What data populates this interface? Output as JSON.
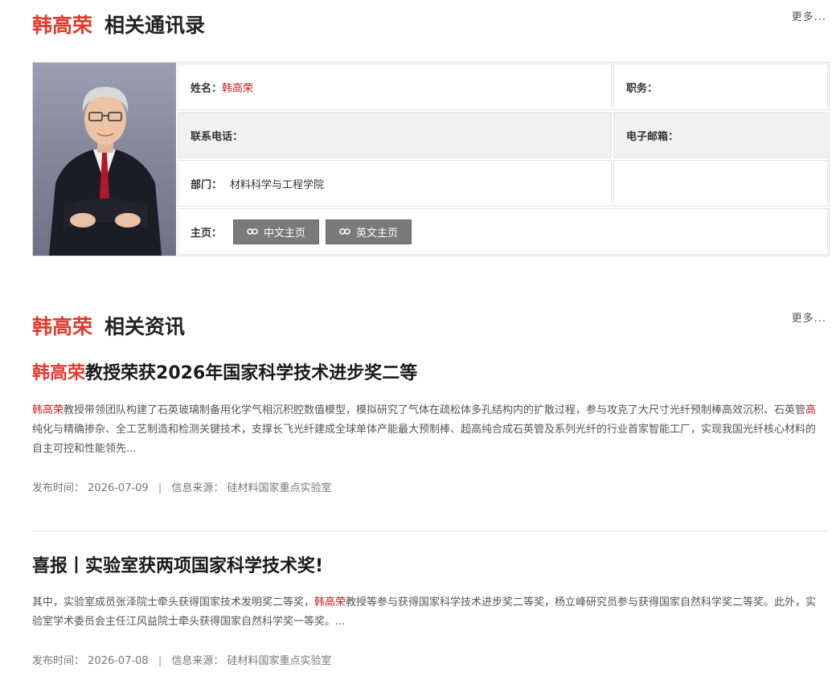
{
  "person_name": "韩高荣",
  "contacts_section": {
    "title": "相关通讯录",
    "more": "更多..."
  },
  "contact": {
    "name_label": "姓名：",
    "name_value": "韩高荣",
    "position_label": "职务：",
    "phone_label": "联系电话：",
    "email_label": "电子邮箱：",
    "dept_label": "部门：",
    "dept_value": "材料科学与工程学院",
    "homepage_label": "主页：",
    "btn_cn": "中文主页",
    "btn_en": "英文主页"
  },
  "news_section": {
    "title": "相关资讯",
    "more": "更多..."
  },
  "news": [
    {
      "title_highlight": "韩高荣",
      "title_rest": "教授荣获2026年国家科学技术进步奖二等",
      "body_pre": "",
      "body_highlight": "韩高荣",
      "body_post_a": "教授带领团队构建了石英玻璃制备用化学气相沉积腔数值模型，模拟研究了气体在疏松体多孔结构内的扩散过程，参与攻克了大尺寸光纤预制棒高效沉积、石英管",
      "body_highlight2": "高",
      "body_post_b": "纯化与精确掺杂、全工艺制造和检测关键技术，支撑长飞光纤建成全球单体产能最大预制棒、超高纯合成石英管及系列光纤的行业首家智能工厂，实现我国光纤核心材料的自主可控和性能领先...",
      "date_label": "发布时间：",
      "date": "2026-07-09",
      "source_label": "信息来源：",
      "source": "硅材料国家重点实验室"
    },
    {
      "title_highlight": "",
      "title_rest": "喜报丨实验室获两项国家科学技术奖!",
      "body_pre": "其中，实验室成员张泽院士牵头获得国家技术发明奖二等奖，",
      "body_highlight": "韩高荣",
      "body_post_a": "教授等参与获得国家科学技术进步奖二等奖，杨立峰研究员参与获得国家自然科学奖二等奖。此外，实验室学术委员会主任江风益院士牵头获得国家自然科学奖一等奖。...",
      "body_highlight2": "",
      "body_post_b": "",
      "date_label": "发布时间：",
      "date": "2026-07-08",
      "source_label": "信息来源：",
      "source": "硅材料国家重点实验室"
    }
  ],
  "meta_separator": "|",
  "colors": {
    "accent_red": "#e23a2e",
    "button_grey": "#7a7a7a"
  }
}
